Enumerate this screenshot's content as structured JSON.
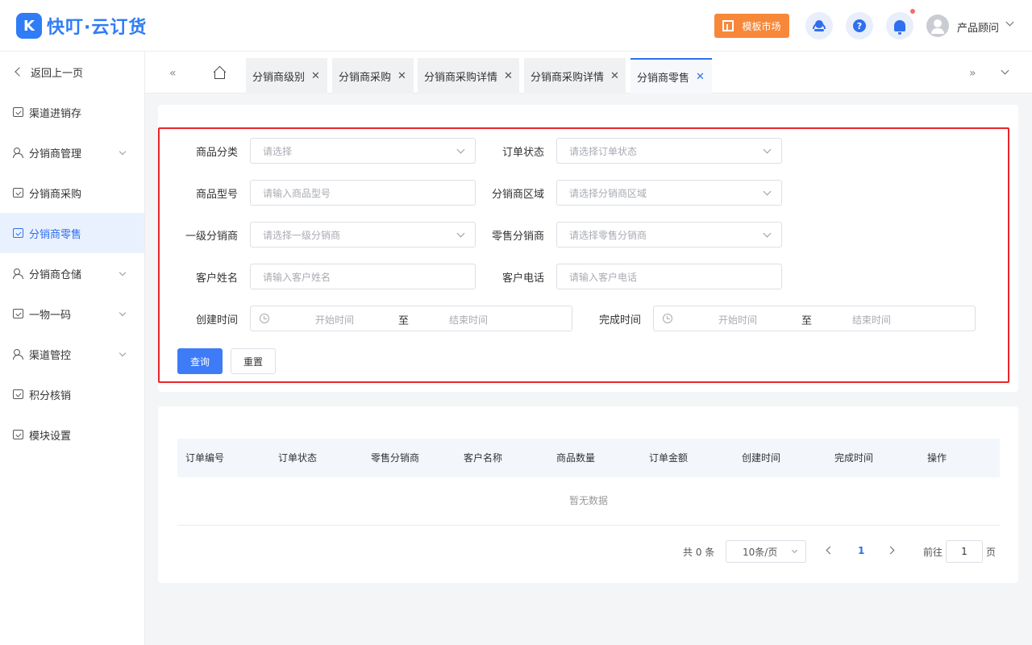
{
  "header": {
    "logo_mark": "K",
    "logo_text": "快叮·云订货",
    "template_market": "模板市场",
    "help": "?",
    "user_name": "产品顾问"
  },
  "sidebar": {
    "back": "返回上一页",
    "items": [
      {
        "label": "渠道进销存"
      },
      {
        "label": "分销商管理"
      },
      {
        "label": "分销商采购"
      },
      {
        "label": "分销商零售"
      },
      {
        "label": "分销商仓储"
      },
      {
        "label": "一物一码"
      },
      {
        "label": "渠道管控"
      },
      {
        "label": "积分核销"
      },
      {
        "label": "模块设置"
      }
    ]
  },
  "tabs": {
    "items": [
      {
        "label": "分销商级别"
      },
      {
        "label": "分销商采购"
      },
      {
        "label": "分销商采购详情"
      },
      {
        "label": "分销商采购详情"
      },
      {
        "label": "分销商零售"
      }
    ]
  },
  "filters": {
    "category_label": "商品分类",
    "category_placeholder": "请选择",
    "order_status_label": "订单状态",
    "order_status_placeholder": "请选择订单状态",
    "model_label": "商品型号",
    "model_placeholder": "请输入商品型号",
    "region_label": "分销商区域",
    "region_placeholder": "请选择分销商区域",
    "level1_label": "一级分销商",
    "level1_placeholder": "请选择一级分销商",
    "retail_label": "零售分销商",
    "retail_placeholder": "请选择零售分销商",
    "customer_name_label": "客户姓名",
    "customer_name_placeholder": "请输入客户姓名",
    "customer_phone_label": "客户电话",
    "customer_phone_placeholder": "请输入客户电话",
    "created_label": "创建时间",
    "completed_label": "完成时间",
    "start_placeholder": "开始时间",
    "range_sep": "至",
    "end_placeholder": "结束时间",
    "query_btn": "查询",
    "reset_btn": "重置"
  },
  "table": {
    "columns": [
      "订单编号",
      "订单状态",
      "零售分销商",
      "客户名称",
      "商品数量",
      "订单金额",
      "创建时间",
      "完成时间",
      "操作"
    ],
    "empty_text": "暂无数据"
  },
  "pagination": {
    "total": "共 0 条",
    "page_size": "10条/页",
    "current": "1",
    "goto_label": "前往",
    "goto_value": "1",
    "goto_unit": "页"
  }
}
